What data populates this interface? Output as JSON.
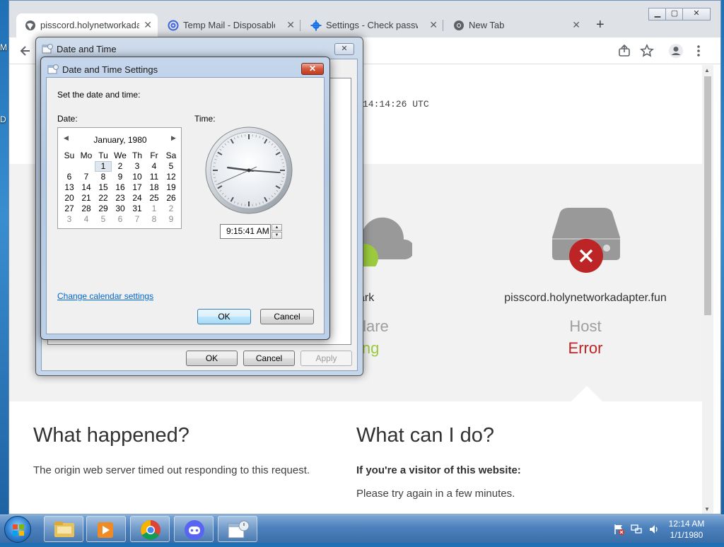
{
  "desktop": {
    "edge_label_1": "M",
    "edge_label_2": "D"
  },
  "browser": {
    "tabs": [
      {
        "label": "pisscord.holynetworkadapter.fun",
        "active": true,
        "icon": "globe-icon"
      },
      {
        "label": "Temp Mail - Disposable Temporary Email",
        "active": false,
        "icon": "at-sign-icon"
      },
      {
        "label": "Settings - Check passwords",
        "active": false,
        "icon": "gear-icon"
      },
      {
        "label": "New Tab",
        "active": false,
        "icon": "chrome-icon"
      }
    ],
    "tab_close_glyph": "✕",
    "new_tab_glyph": "+",
    "window_controls": {
      "minimize": "▁",
      "maximize": "▢",
      "close": "✕"
    },
    "toolbar_icons": [
      "back-arrow-icon",
      "share-icon",
      "bookmark-star-icon",
      "profile-icon",
      "kebab-menu-icon"
    ]
  },
  "page": {
    "timestamp": "14:14:26 UTC",
    "diagnostics": {
      "cloud_label_partial": "ark",
      "cloud_status_partial": "flare",
      "cloud_state_partial": "ing",
      "host_label": "pisscord.holynetworkadapter.fun",
      "host_status": "Host",
      "host_state": "Error",
      "colors": {
        "working": "#9bca3e",
        "error": "#bd2426",
        "status_gray": "#9e9e9e"
      }
    },
    "what_happened": {
      "heading": "What happened?",
      "text": "The origin web server timed out responding to this request."
    },
    "what_can_i_do": {
      "heading": "What can I do?",
      "visitor_heading": "If you're a visitor of this website:",
      "visitor_text": "Please try again in a few minutes."
    }
  },
  "outer_dialog": {
    "title": "Date and Time",
    "close_glyph": "✕",
    "buttons": {
      "ok": "OK",
      "cancel": "Cancel",
      "apply": "Apply"
    }
  },
  "inner_dialog": {
    "title": "Date and Time Settings",
    "close_glyph": "✕",
    "instruction": "Set the date and time:",
    "date_label": "Date:",
    "time_label": "Time:",
    "calendar": {
      "month_year": "January, 1980",
      "prev_glyph": "◀",
      "next_glyph": "▶",
      "weekdays": [
        "Su",
        "Mo",
        "Tu",
        "We",
        "Th",
        "Fr",
        "Sa"
      ],
      "weeks": [
        [
          "",
          "",
          "1",
          "2",
          "3",
          "4",
          "5"
        ],
        [
          "6",
          "7",
          "8",
          "9",
          "10",
          "11",
          "12"
        ],
        [
          "13",
          "14",
          "15",
          "16",
          "17",
          "18",
          "19"
        ],
        [
          "20",
          "21",
          "22",
          "23",
          "24",
          "25",
          "26"
        ],
        [
          "27",
          "28",
          "29",
          "30",
          "31",
          "1",
          "2"
        ],
        [
          "3",
          "4",
          "5",
          "6",
          "7",
          "8",
          "9"
        ]
      ],
      "selected_day": "1"
    },
    "clock": {
      "hour": 9,
      "minute": 15,
      "second": 41
    },
    "time_value": "9:15:41 AM",
    "spin_up": "▲",
    "spin_down": "▼",
    "change_calendar_link": "Change calendar settings",
    "ok": "OK",
    "cancel": "Cancel"
  },
  "taskbar": {
    "apps": [
      "windows-explorer-icon",
      "media-player-icon",
      "chrome-icon",
      "discord-icon",
      "date-time-control-panel-icon"
    ],
    "tray_icons": [
      "action-center-flag-icon",
      "network-icon",
      "volume-icon"
    ],
    "time": "12:14 AM",
    "date": "1/1/1980"
  }
}
